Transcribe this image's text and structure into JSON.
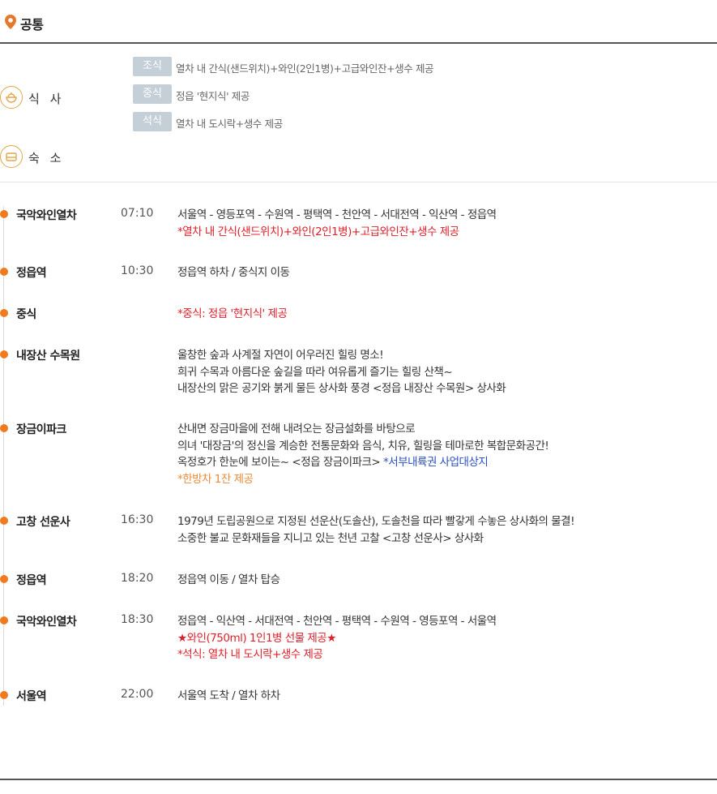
{
  "header": {
    "title": "공통",
    "icon": "location-pin-icon",
    "accent": "#e4782c"
  },
  "categories": {
    "meal": {
      "label": "식 사",
      "icon": "meal-bowl-icon"
    },
    "hotel": {
      "label": "숙 소",
      "icon": "bed-icon"
    }
  },
  "meals": [
    {
      "badge": "조식",
      "text": "열차 내 간식(샌드위치)+와인(2인1병)+고급와인잔+생수 제공"
    },
    {
      "badge": "중식",
      "text": "정읍 '현지식' 제공"
    },
    {
      "badge": "석식",
      "text": "열차 내 도시락+생수 제공"
    }
  ],
  "timeline": [
    {
      "place": "국악와인열차",
      "time": "07:10",
      "lines": [
        {
          "text": "서울역 - 영등포역 - 수원역 - 평택역 - 천안역 - 서대전역 - 익산역 - 정읍역"
        },
        {
          "text": "*열차 내 간식(샌드위치)+와인(2인1병)+고급와인잔+생수 제공",
          "style": "red"
        }
      ]
    },
    {
      "place": "정읍역",
      "time": "10:30",
      "lines": [
        {
          "text": "정읍역 하차 / 중식지 이동"
        }
      ]
    },
    {
      "place": "중식",
      "time": "",
      "lines": [
        {
          "text": "*중식: 정읍 '현지식' 제공",
          "style": "red"
        }
      ]
    },
    {
      "place": "내장산 수목원",
      "time": "",
      "lines": [
        {
          "text": "울창한 숲과 사계절 자연이 어우러진 힐링 명소!"
        },
        {
          "text": "희귀 수목과 아름다운 숲길을 따라 여유롭게 즐기는 힐링 산책~"
        },
        {
          "text": "내장산의 맑은 공기와 붉게 물든 상사화 풍경 <정읍 내장산 수목원> 상사화"
        }
      ]
    },
    {
      "place": "장금이파크",
      "time": "",
      "lines": [
        {
          "text": "산내면 장금마을에 전해 내려오는 장금설화를 바탕으로"
        },
        {
          "text": "의녀 '대장금'의 정신을 계승한 전통문화와 음식, 치유, 힐링을 테마로한 복합문화공간!"
        },
        {
          "text": "옥정호가 한눈에 보이는~ <정읍 장금이파크>",
          "suffix": " *서부내륙권 사업대상지",
          "suffix_style": "blue"
        },
        {
          "text": "*한방차 1잔 제공",
          "style": "orange"
        }
      ]
    },
    {
      "place": "고창 선운사",
      "time": "16:30",
      "lines": [
        {
          "text": "1979년 도립공원으로 지정된 선운산(도솔산), 도솔천을 따라 빨갛게 수놓은 상사화의 물결!"
        },
        {
          "text": "소중한 불교 문화재들을 지니고 있는 천년 고찰 <고창 선운사> 상사화"
        }
      ]
    },
    {
      "place": "정읍역",
      "time": "18:20",
      "lines": [
        {
          "text": "정읍역 이동 / 열차 탑승"
        }
      ]
    },
    {
      "place": "국악와인열차",
      "time": "18:30",
      "lines": [
        {
          "text": "정읍역 - 익산역 - 서대전역 - 천안역 - 평택역 - 수원역 - 영등포역 - 서울역"
        },
        {
          "text": "★와인(750ml) 1인1병 선물 제공★",
          "style": "red"
        },
        {
          "text": "*석식: 열차 내 도시락+생수 제공",
          "style": "red"
        }
      ]
    },
    {
      "place": "서울역",
      "time": "22:00",
      "lines": [
        {
          "text": "서울역 도착 / 열차 하차"
        }
      ]
    }
  ],
  "colors": {
    "dot": "#f07b1f",
    "red_note": "#e0202a",
    "orange_note": "#ec8a3a",
    "blue_note": "#2b4fc2",
    "badge_bg": "#c5cfd8"
  }
}
